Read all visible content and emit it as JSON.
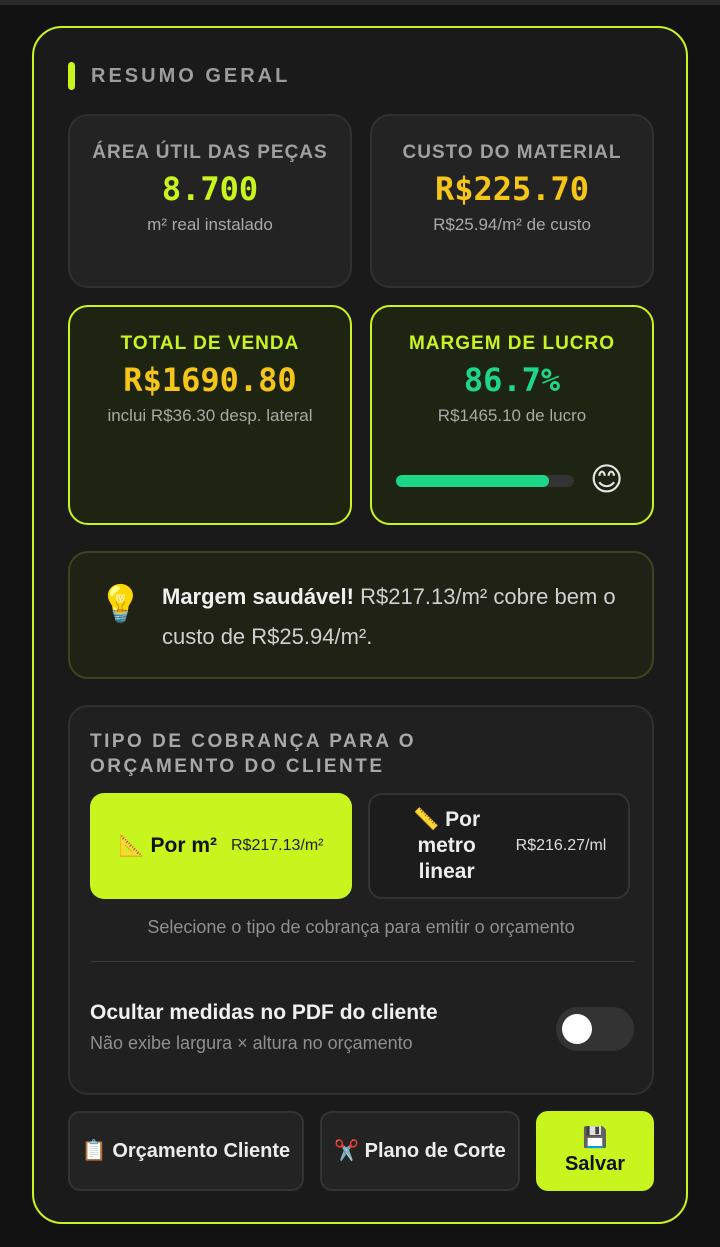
{
  "summary": {
    "heading": "RESUMO GERAL",
    "area": {
      "label": "ÁREA ÚTIL DAS PEÇAS",
      "value": "8.700",
      "sub": "m² real instalado"
    },
    "custo": {
      "label": "CUSTO DO MATERIAL",
      "value": "R$225.70",
      "sub": "R$25.94/m² de custo"
    },
    "total": {
      "label": "TOTAL DE VENDA",
      "value": "R$1690.80",
      "sub": "inclui R$36.30 desp. lateral"
    },
    "margem": {
      "label": "MARGEM DE LUCRO",
      "value": "86.7%",
      "sub": "R$1465.10 de lucro",
      "progress_fraction": 0.86,
      "mood_emoji": "😊"
    }
  },
  "tip": {
    "icon": "💡",
    "bold": "Margem saudável!",
    "text": " R$217.13/m² cobre bem o custo de R$25.94/m²."
  },
  "billing": {
    "title": "TIPO DE COBRANÇA PARA O ORÇAMENTO DO CLIENTE",
    "options": [
      {
        "icon": "📐",
        "label": "Por m²",
        "price": "R$217.13/m²",
        "selected": true
      },
      {
        "icon": "📏",
        "label": "Por metro linear",
        "price": "R$216.27/ml",
        "selected": false
      }
    ],
    "hint": "Selecione o tipo de cobrança para emitir o orçamento",
    "hide_measures": {
      "label": "Ocultar medidas no PDF do cliente",
      "sub": "Não exibe largura × altura no orçamento",
      "enabled": false
    }
  },
  "actions": {
    "orcamento": {
      "icon": "📋",
      "label": "Orçamento Cliente"
    },
    "plano": {
      "icon": "✂️",
      "label": "Plano de Corte"
    },
    "salvar": {
      "icon": "💾",
      "label": "Salvar"
    }
  },
  "colors": {
    "accent": "#c8f51e",
    "gold": "#f5c518",
    "teal": "#1ed68a"
  }
}
